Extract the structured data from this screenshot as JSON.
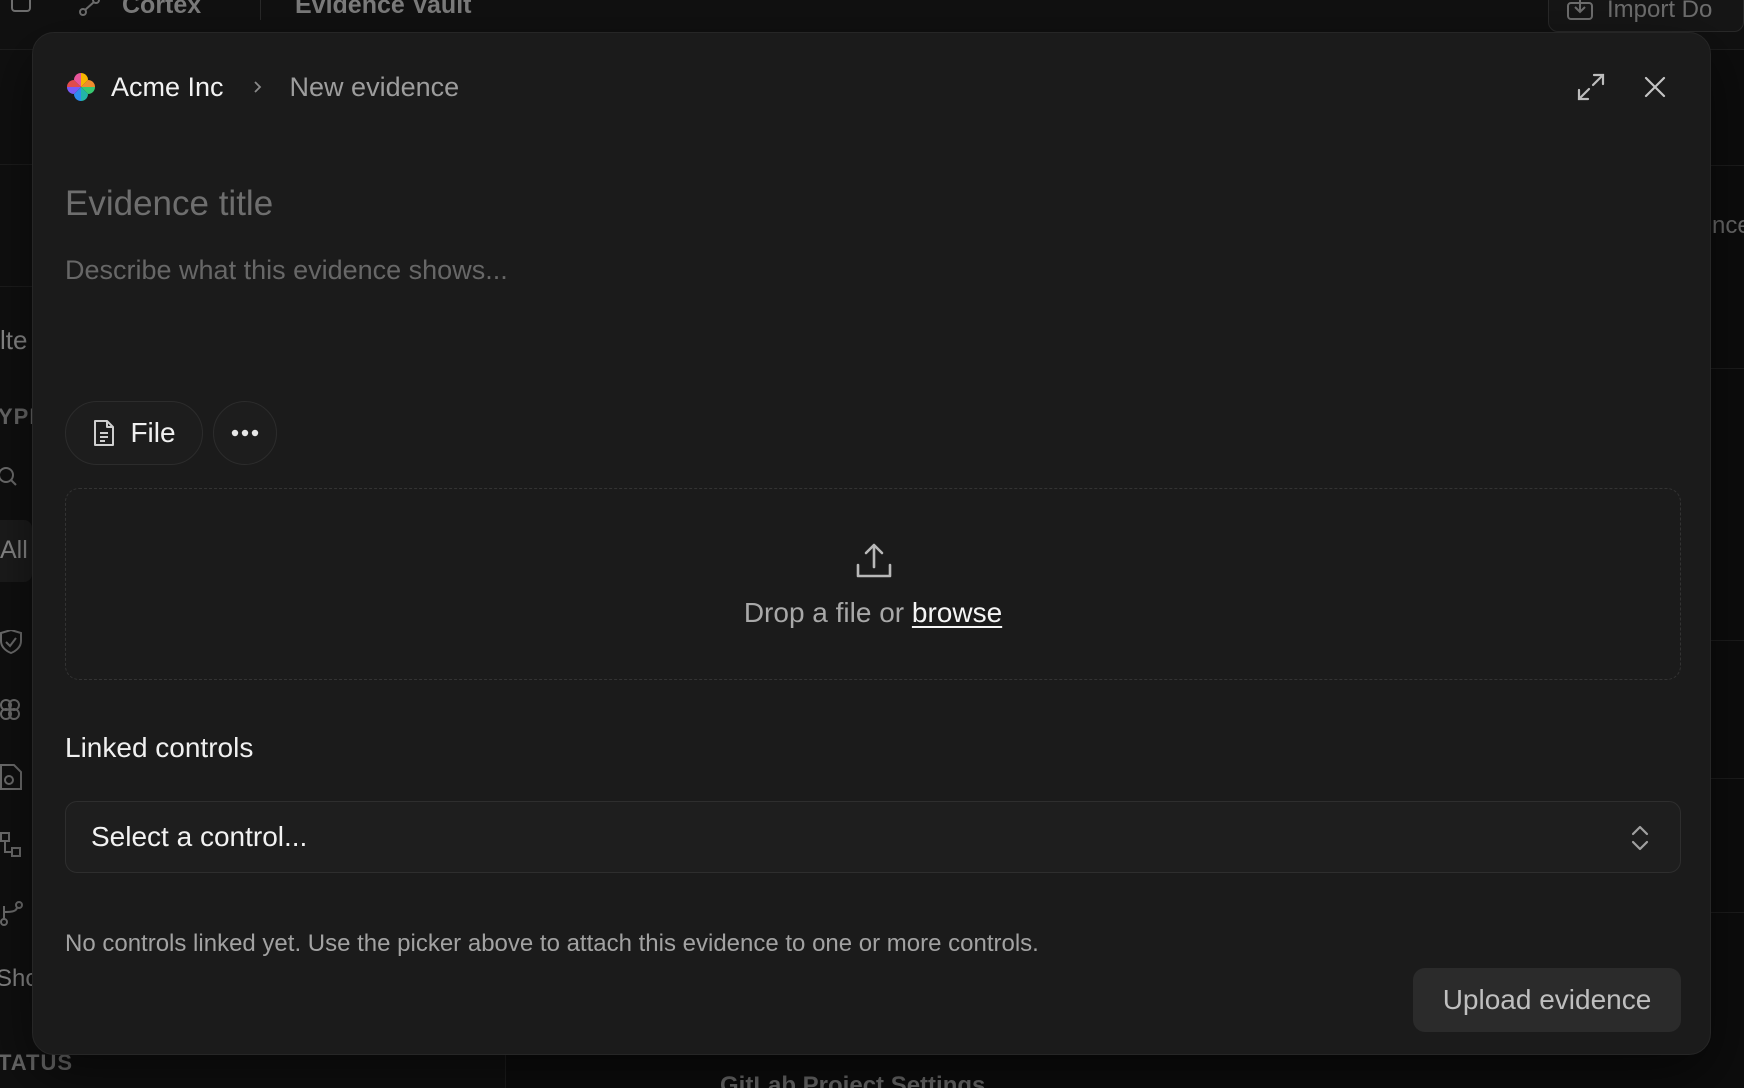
{
  "background": {
    "topbar": {
      "cortex_label": "Cortex",
      "vault_label": "Evidence Vault",
      "import_label": "Import Do"
    },
    "sidebar": {
      "filter_label": "lte",
      "type_heading": "YPE",
      "all_label": "All",
      "show_label": "Sho",
      "status_heading": "TATUS"
    },
    "right_fragment": "nce",
    "bottom_row_label": "GitLab Project Settings"
  },
  "modal": {
    "org_name": "Acme Inc",
    "breadcrumb_current": "New evidence",
    "title_placeholder": "Evidence title",
    "description_placeholder": "Describe what this evidence shows...",
    "file_chip_label": "File",
    "dropzone": {
      "prefix": "Drop a file or ",
      "browse_label": "browse"
    },
    "linked_controls_label": "Linked controls",
    "control_select_value": "Select a control...",
    "hint": "No controls linked yet. Use the picker above to attach this evidence to one or more controls.",
    "submit_label": "Upload evidence"
  },
  "icons": {
    "org_logo": "pinwheel-logo-icon",
    "breadcrumb_separator": "chevron-right-icon",
    "expand": "expand-icon",
    "close": "close-icon",
    "file": "file-icon",
    "more": "more-horizontal-icon",
    "upload": "upload-icon",
    "select_toggle": "chevron-up-down-icon"
  }
}
